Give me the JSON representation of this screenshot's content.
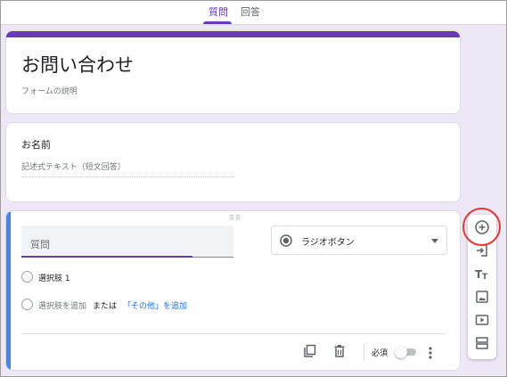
{
  "tabs": [
    {
      "label": "質問",
      "active": true
    },
    {
      "label": "回答",
      "active": false
    }
  ],
  "form": {
    "title": "お問い合わせ",
    "description": "フォームの説明"
  },
  "question1": {
    "title": "お名前",
    "answer_placeholder": "記述式テキスト（短文回答）"
  },
  "active_question": {
    "placeholder": "質問",
    "type_label": "ラジオボタン",
    "options": [
      {
        "label": "選択肢 1"
      }
    ],
    "add_option_label": "選択肢を追加",
    "or_label": "または",
    "add_other_label": "「その他」を追加",
    "required_label": "必須",
    "required": false
  },
  "toolbar_icons": [
    "add-question-icon",
    "import-questions-icon",
    "add-title-icon",
    "add-image-icon",
    "add-video-icon",
    "add-section-icon"
  ],
  "colors": {
    "accent": "#673ab7",
    "active_border": "#4285f4",
    "link": "#1a73e8",
    "highlight": "#e53935",
    "background": "#ede7f6"
  }
}
